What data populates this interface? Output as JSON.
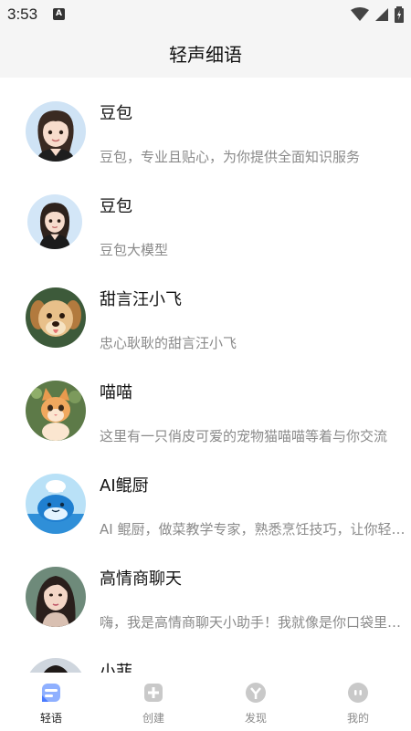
{
  "status_bar": {
    "time": "3:53",
    "notification_badge": "A"
  },
  "header": {
    "title": "轻声细语"
  },
  "chats": [
    {
      "name": "豆包",
      "description": "豆包，专业且贴心，为你提供全面知识服务",
      "avatar": "doubao-girl-avatar"
    },
    {
      "name": "豆包",
      "description": "豆包大模型",
      "avatar": "doubao-girl-avatar-small"
    },
    {
      "name": "甜言汪小飞",
      "description": "忠心耿耿的甜言汪小飞",
      "avatar": "puppy-avatar"
    },
    {
      "name": "喵喵",
      "description": "这里有一只俏皮可爱的宠物猫喵喵等着与你交流",
      "avatar": "kitten-avatar"
    },
    {
      "name": "AI鲲厨",
      "description": "AI 鲲厨，做菜教学专家，熟悉烹饪技巧，让你轻松下厨",
      "avatar": "whale-chef-avatar"
    },
    {
      "name": "高情商聊天",
      "description": "嗨，我是高情商聊天小助手！我就像是你口袋里的好友",
      "avatar": "woman-portrait-avatar"
    },
    {
      "name": "小菲",
      "description": "",
      "avatar": "xiaofei-avatar"
    }
  ],
  "tabs": [
    {
      "label": "轻语",
      "icon": "chat-bubble-icon",
      "active": true
    },
    {
      "label": "创建",
      "icon": "plus-square-icon",
      "active": false
    },
    {
      "label": "发现",
      "icon": "discover-icon",
      "active": false
    },
    {
      "label": "我的",
      "icon": "profile-icon",
      "active": false
    }
  ],
  "colors": {
    "accent": "#4a7bff",
    "muted_text": "#8a8a8a",
    "header_bg": "#f5f5f5"
  }
}
